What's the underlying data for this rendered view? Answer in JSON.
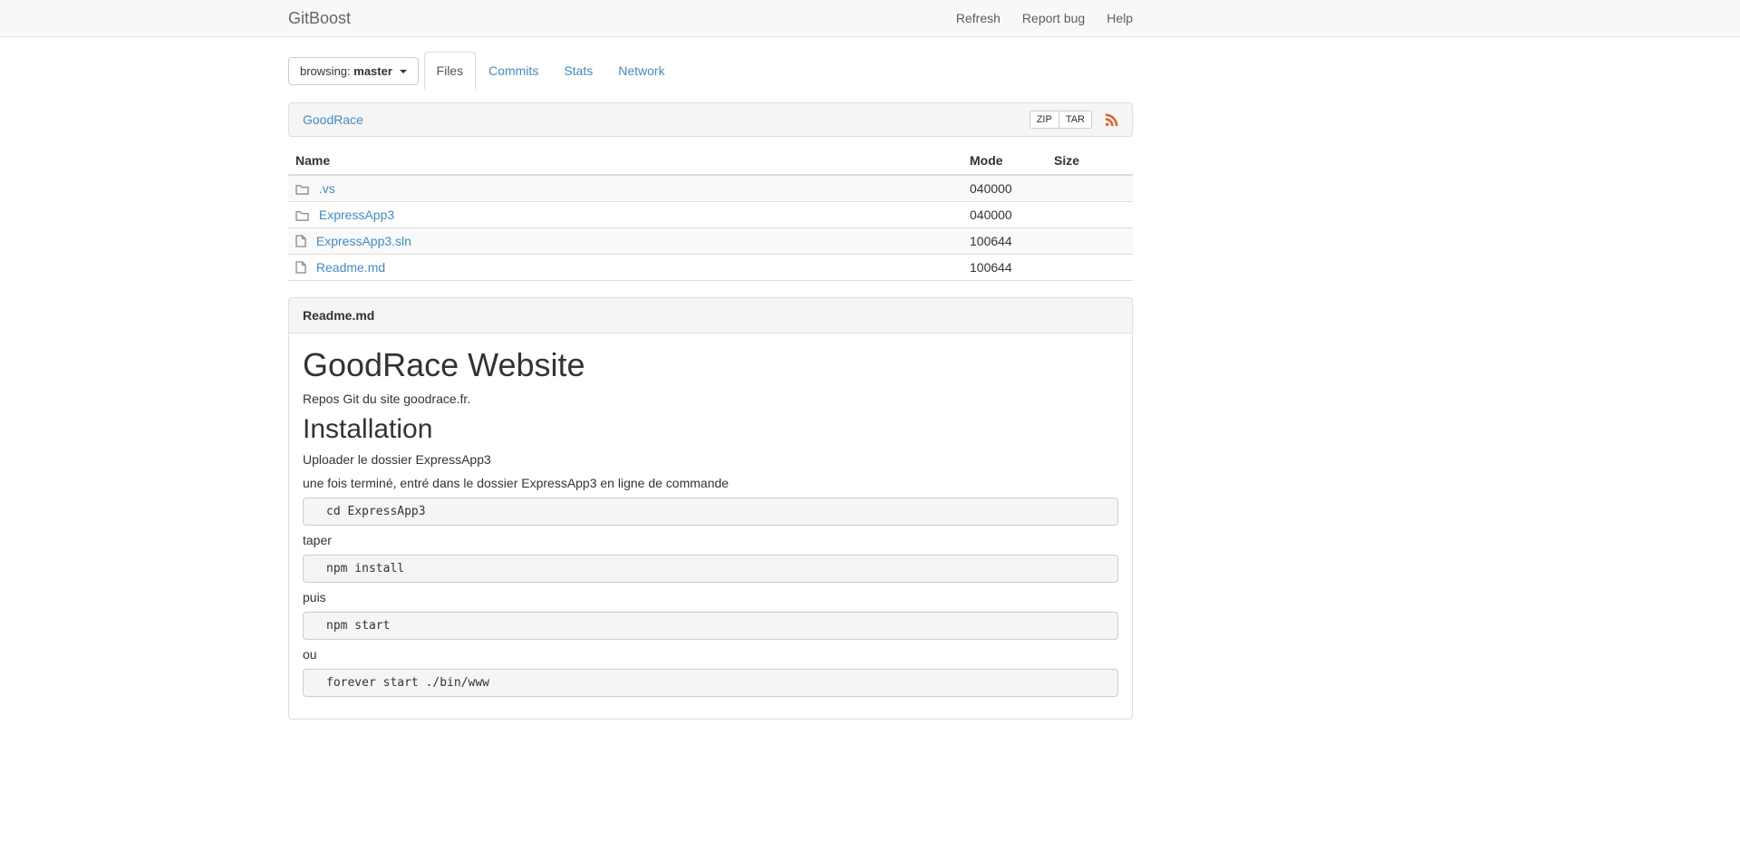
{
  "navbar": {
    "brand": "GitBoost",
    "links": [
      {
        "label": "Refresh"
      },
      {
        "label": "Report bug"
      },
      {
        "label": "Help"
      }
    ]
  },
  "toolbar": {
    "browsing_label": "browsing:",
    "branch": "master",
    "tabs": [
      {
        "label": "Files",
        "active": true
      },
      {
        "label": "Commits",
        "active": false
      },
      {
        "label": "Stats",
        "active": false
      },
      {
        "label": "Network",
        "active": false
      }
    ]
  },
  "repo_panel": {
    "title": "GoodRace",
    "zip_label": "ZIP",
    "tar_label": "TAR",
    "feed_icon": "rss-icon"
  },
  "file_table": {
    "columns": [
      "Name",
      "Mode",
      "Size"
    ],
    "rows": [
      {
        "icon": "folder-icon",
        "name": ".vs",
        "mode": "040000",
        "size": ""
      },
      {
        "icon": "folder-icon",
        "name": "ExpressApp3",
        "mode": "040000",
        "size": ""
      },
      {
        "icon": "file-icon",
        "name": "ExpressApp3.sln",
        "mode": "100644",
        "size": ""
      },
      {
        "icon": "file-icon",
        "name": "Readme.md",
        "mode": "100644",
        "size": ""
      }
    ]
  },
  "readme_panel": {
    "title": "Readme.md",
    "h1": "GoodRace Website",
    "intro": "Repos Git du site goodrace.fr.",
    "h2": "Installation",
    "p1": "Uploader le dossier ExpressApp3",
    "p2": "une fois terminé, entré dans le dossier ExpressApp3 en ligne de commande",
    "code1": "cd ExpressApp3",
    "p3": "taper",
    "code2": "npm install",
    "p4": "puis",
    "code3": "npm start",
    "p5": "ou",
    "code4": "forever start ./bin/www"
  },
  "colors": {
    "link_blue": "#428bca",
    "navbar_bg": "#f8f8f8",
    "panel_heading_bg": "#f5f5f5",
    "border": "#dddddd",
    "rss_orange": "#e0642f",
    "stripe": "#f9f9f9"
  }
}
